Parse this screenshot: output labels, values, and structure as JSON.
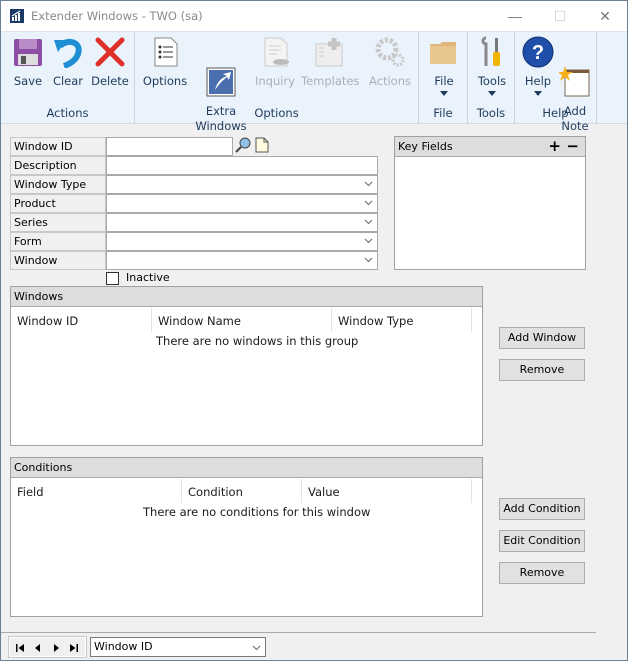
{
  "window": {
    "title": "Extender Windows  -  TWO (sa)",
    "controls": {
      "minimize": "—",
      "maximize": "☐",
      "close": "✕"
    }
  },
  "ribbon": {
    "groups": [
      {
        "label": "Actions",
        "buttons": [
          {
            "label": "Save",
            "icon": "floppy-disk-icon",
            "enabled": true
          },
          {
            "label": "Clear",
            "icon": "undo-arrow-icon",
            "enabled": true
          },
          {
            "label": "Delete",
            "icon": "red-x-icon",
            "enabled": true
          }
        ]
      },
      {
        "label": "Options",
        "buttons": [
          {
            "label": "Options",
            "icon": "options-list-icon",
            "enabled": true
          },
          {
            "label": "Extra\nWindows",
            "icon": "extra-windows-icon",
            "enabled": true
          },
          {
            "label": "Inquiry",
            "icon": "inquiry-icon",
            "enabled": false
          },
          {
            "label": "Templates",
            "icon": "templates-icon",
            "enabled": false
          },
          {
            "label": "Actions",
            "icon": "gears-icon",
            "enabled": false
          }
        ]
      },
      {
        "label": "File",
        "buttons": [
          {
            "label": "File",
            "icon": "folder-icon",
            "enabled": true,
            "dropdown": true
          }
        ]
      },
      {
        "label": "Tools",
        "buttons": [
          {
            "label": "Tools",
            "icon": "tools-icon",
            "enabled": true,
            "dropdown": true
          }
        ]
      },
      {
        "label": "Help",
        "buttons": [
          {
            "label": "Help",
            "icon": "help-icon",
            "enabled": true,
            "dropdown": true
          },
          {
            "label": "Add\nNote",
            "icon": "note-icon",
            "enabled": true
          }
        ]
      }
    ]
  },
  "form": {
    "fields": [
      {
        "label": "Window ID",
        "value": "",
        "type": "lookup"
      },
      {
        "label": "Description",
        "value": "",
        "type": "text"
      },
      {
        "label": "Window Type",
        "value": "",
        "type": "dropdown"
      },
      {
        "label": "Product",
        "value": "",
        "type": "dropdown"
      },
      {
        "label": "Series",
        "value": "",
        "type": "dropdown"
      },
      {
        "label": "Form",
        "value": "",
        "type": "dropdown"
      },
      {
        "label": "Window",
        "value": "",
        "type": "dropdown"
      }
    ],
    "inactive": {
      "label": "Inactive",
      "checked": false
    }
  },
  "key_fields": {
    "title": "Key Fields",
    "add": "+",
    "remove": "−",
    "items": []
  },
  "windows_panel": {
    "title": "Windows",
    "columns": [
      "Window ID",
      "Window Name",
      "Window Type"
    ],
    "rows": [],
    "empty_message": "There are no windows in this group",
    "buttons": {
      "add": "Add Window",
      "remove": "Remove"
    }
  },
  "conditions_panel": {
    "title": "Conditions",
    "columns": [
      "Field",
      "Condition",
      "Value"
    ],
    "rows": [],
    "empty_message": "There are no conditions for this window",
    "buttons": {
      "add": "Add Condition",
      "edit": "Edit Condition",
      "remove": "Remove"
    }
  },
  "footer": {
    "sort_by": "Window ID"
  },
  "colors": {
    "ribbon_bg": "#eaf2fb",
    "ribbon_text": "#1e3b5c",
    "panel_header": "#dcdddd"
  }
}
